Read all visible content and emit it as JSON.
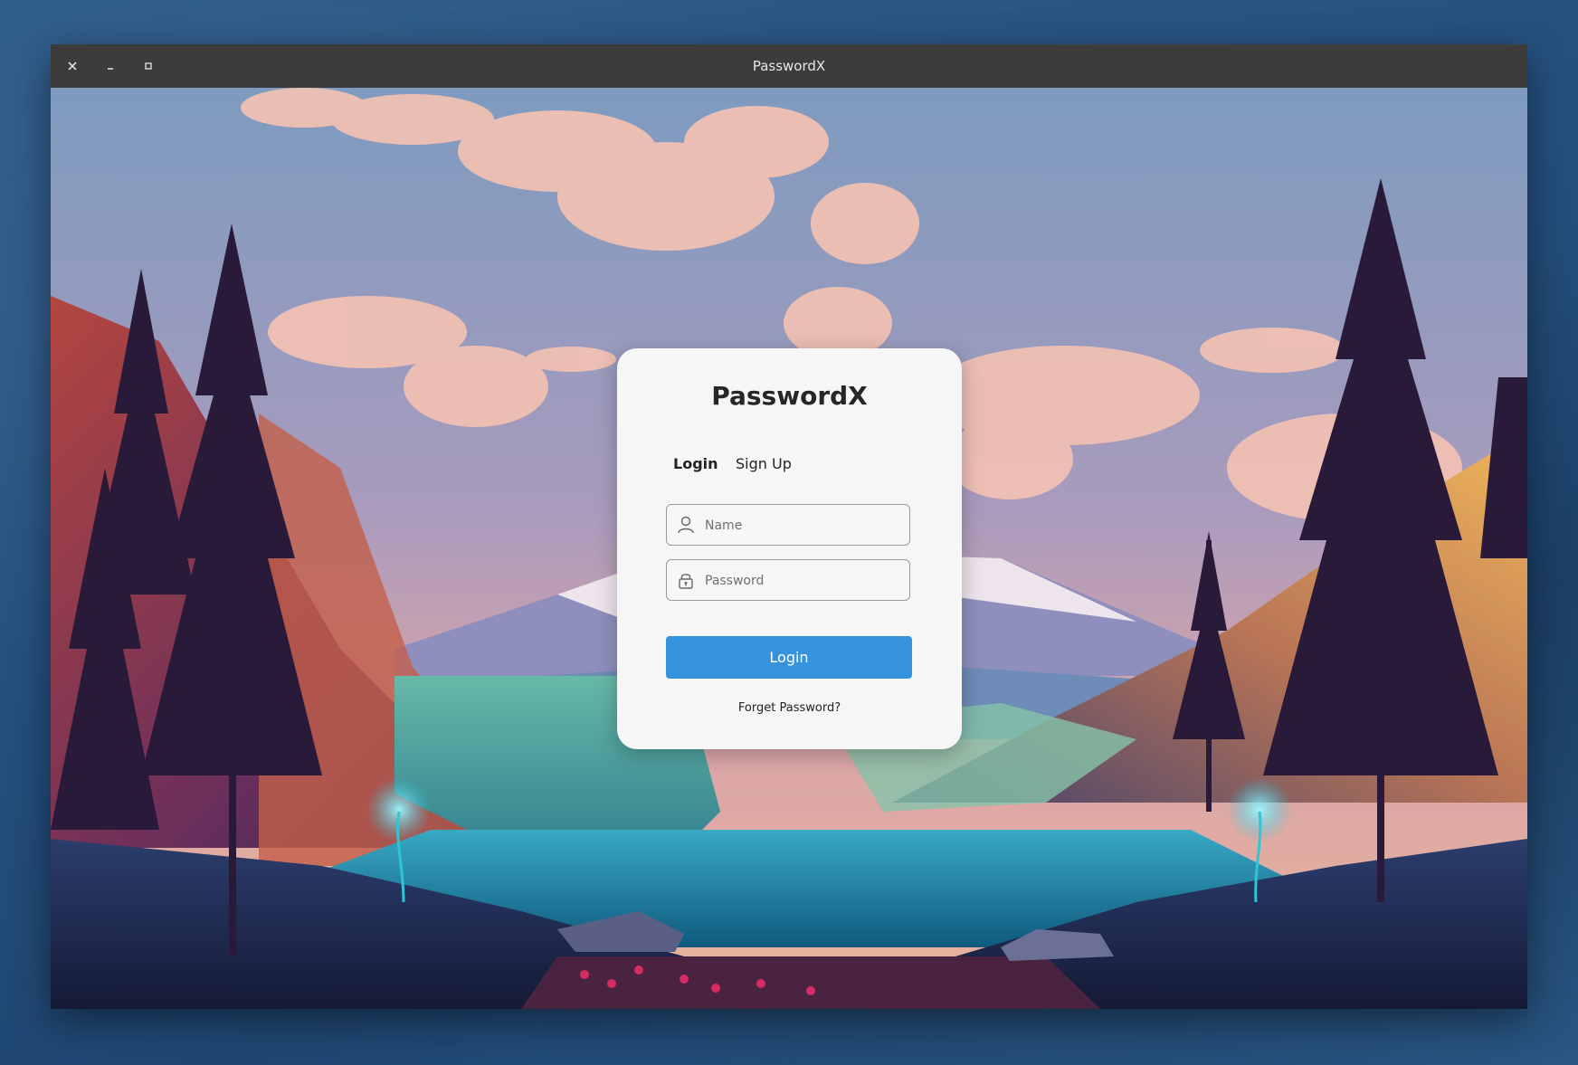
{
  "window": {
    "title": "PasswordX",
    "controls": [
      {
        "name": "close",
        "icon": "close-icon"
      },
      {
        "name": "minimize",
        "icon": "minimize-icon"
      },
      {
        "name": "maximize",
        "icon": "maximize-icon"
      }
    ]
  },
  "background": {
    "description_icon": "landscape-wallpaper"
  },
  "card": {
    "title": "PasswordX",
    "tabs": [
      {
        "label": "Login",
        "active": true
      },
      {
        "label": "Sign Up",
        "active": false
      }
    ],
    "name_field": {
      "placeholder": "Name",
      "value": "",
      "icon": "user-icon"
    },
    "password_field": {
      "placeholder": "Password",
      "value": "",
      "icon": "lock-icon"
    },
    "login_button": "Login",
    "forgot_link": "Forget Password?"
  },
  "colors": {
    "titlebar": "#3c3c3c",
    "card_bg": "#f6f6f6",
    "primary_button": "#3593dd",
    "desktop": "#25507e"
  }
}
